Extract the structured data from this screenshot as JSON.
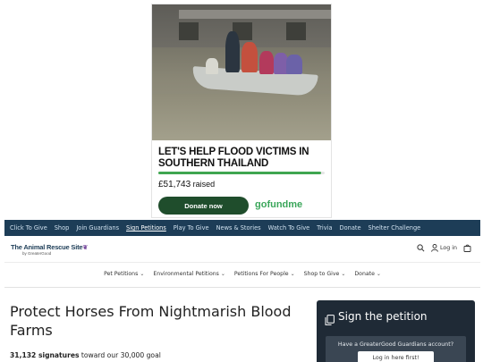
{
  "ad": {
    "headline": "LET'S HELP FLOOD VICTIMS IN SOUTHERN THAILAND",
    "raised_amount": "£51,743",
    "raised_label": "raised",
    "progress_fraction": 0.98,
    "donate_label": "Donate now",
    "brand": "gofundme",
    "colors": {
      "button": "#1f4d2c",
      "progress": "#3fa650",
      "brand": "#3aa65a"
    }
  },
  "topnav": {
    "items": [
      "Click To Give",
      "Shop",
      "Join Guardians",
      "Sign Petitions",
      "Play To Give",
      "News & Stories",
      "Watch To Give",
      "Trivia",
      "Donate",
      "Shelter Challenge"
    ],
    "active": "Sign Petitions",
    "color": "#1d3d57"
  },
  "header": {
    "logo_text": "The Animal Rescue Site",
    "logo_sub": "by GreaterGood",
    "login_label": "Log in",
    "icons": [
      "search-icon",
      "user-icon",
      "cart-icon"
    ]
  },
  "catnav": {
    "items": [
      "Pet Petitions",
      "Environmental Petitions",
      "Petitions For People",
      "Shop to Give",
      "Donate"
    ]
  },
  "main": {
    "title": "Protect Horses From Nightmarish Blood Farms",
    "signatures": "31,132 signatures",
    "goal_text": "toward our 30,000 goal"
  },
  "sign_panel": {
    "title": "Sign the petition",
    "guardians_prompt": "Have a GreaterGood Guardians account?",
    "login_button": "Log in here first!",
    "color": "#1f2a36"
  }
}
